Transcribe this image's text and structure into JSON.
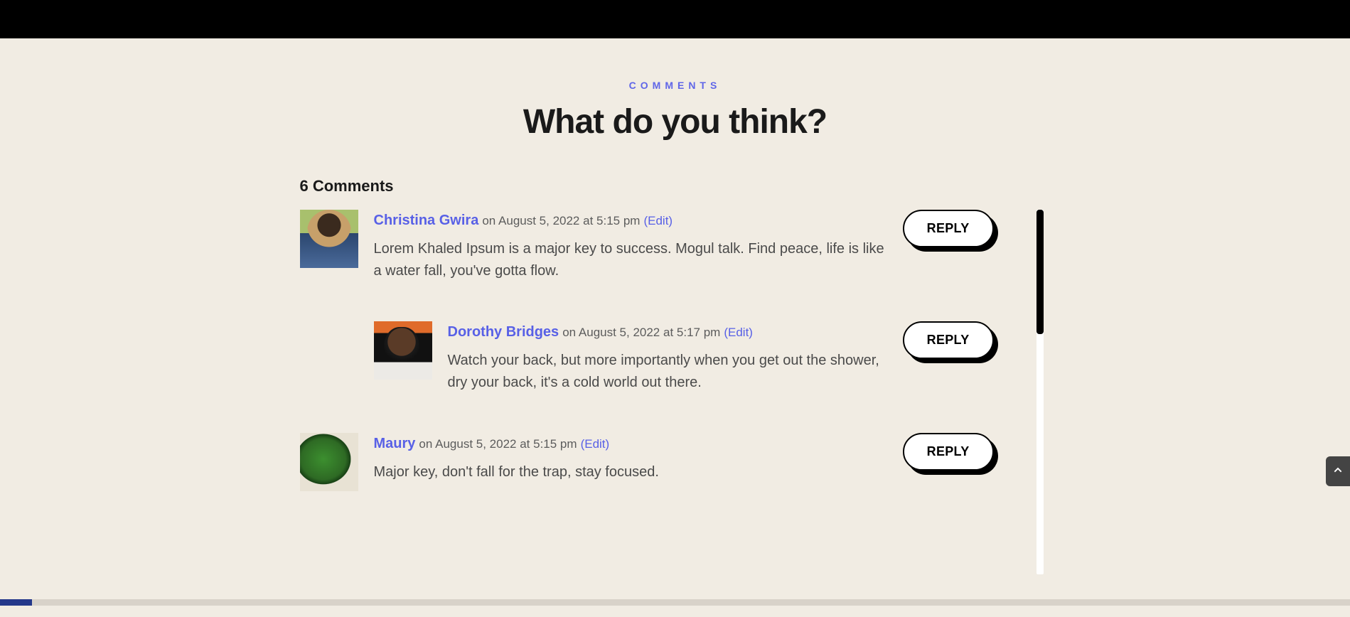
{
  "section": {
    "label": "COMMENTS",
    "heading": "What do you think?",
    "count_label": "6 Comments"
  },
  "reply_label": "REPLY",
  "comments": [
    {
      "author": "Christina Gwira",
      "date": "on August 5, 2022 at 5:15 pm",
      "edit": "(Edit)",
      "text": "Lorem Khaled Ipsum is a major key to success. Mogul talk. Find peace, life is like a water fall, you've gotta flow.",
      "indent": false
    },
    {
      "author": "Dorothy Bridges",
      "date": "on August 5, 2022 at 5:17 pm",
      "edit": "(Edit)",
      "text": "Watch your back, but more importantly when you get out the shower, dry your back, it's a cold world out there.",
      "indent": true
    },
    {
      "author": "Maury",
      "date": "on August 5, 2022 at 5:15 pm",
      "edit": "(Edit)",
      "text": "Major key, don't fall for the trap, stay focused.",
      "indent": false
    }
  ]
}
